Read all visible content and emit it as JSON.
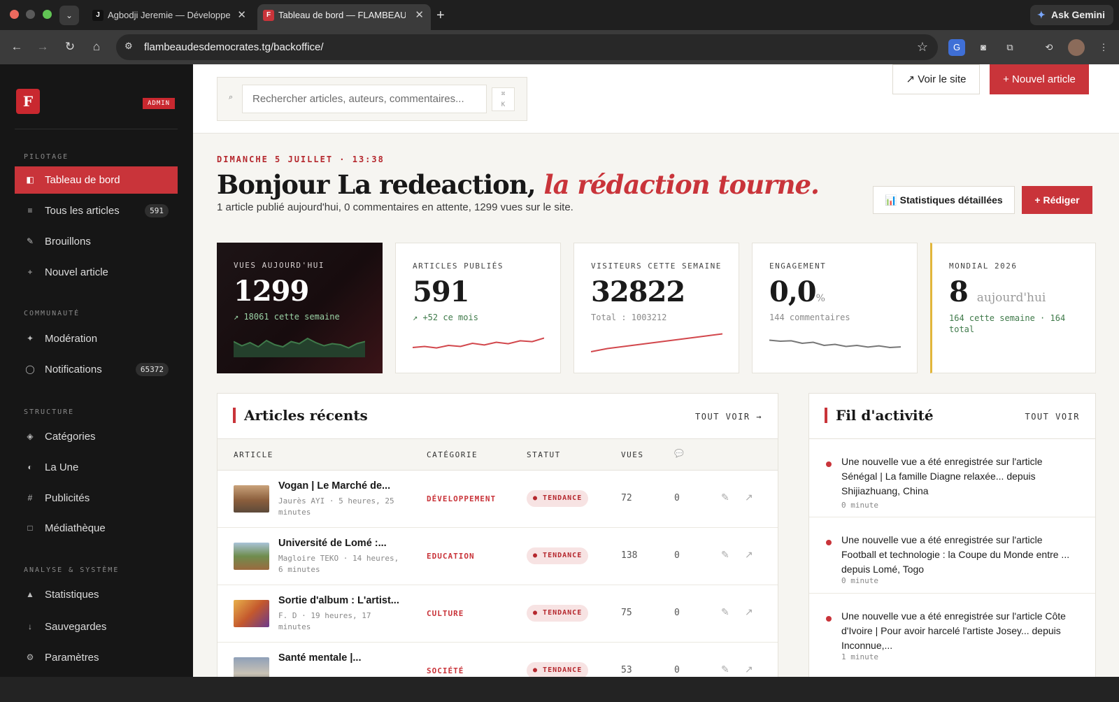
{
  "browser": {
    "tabs": [
      {
        "favicon": "J",
        "title": "Agbodji Jeremie — Développe",
        "active": false
      },
      {
        "favicon": "F",
        "title": "Tableau de bord — FLAMBEAU",
        "active": true
      }
    ],
    "gemini_label": "Ask Gemini",
    "url": "flambeaudesdemocrates.tg/backoffice/"
  },
  "sidebar": {
    "logo": "F",
    "badge": "ADMIN",
    "sections": {
      "pilotage": "PILOTAGE",
      "communaute": "COMMUNAUTÉ",
      "structure": "STRUCTURE",
      "analyse": "ANALYSE & SYSTÈME"
    },
    "items": {
      "dashboard": {
        "label": "Tableau de bord",
        "icon": "◧"
      },
      "articles": {
        "label": "Tous les articles",
        "icon": "≡",
        "count": "591"
      },
      "drafts": {
        "label": "Brouillons",
        "icon": "✎"
      },
      "new": {
        "label": "Nouvel article",
        "icon": "+"
      },
      "moderation": {
        "label": "Modération",
        "icon": "✦"
      },
      "notifications": {
        "label": "Notifications",
        "icon": "◯",
        "count": "65372"
      },
      "categories": {
        "label": "Catégories",
        "icon": "◈"
      },
      "laune": {
        "label": "La Une",
        "icon": "◐"
      },
      "pubs": {
        "label": "Publicités",
        "icon": "#"
      },
      "media": {
        "label": "Médiathèque",
        "icon": "□"
      },
      "stats": {
        "label": "Statistiques",
        "icon": "▲"
      },
      "backups": {
        "label": "Sauvegardes",
        "icon": "↓"
      },
      "settings": {
        "label": "Paramètres",
        "icon": "⚙"
      }
    }
  },
  "topbar": {
    "search_placeholder": "Rechercher articles, auteurs, commentaires...",
    "kbd_top": "⌘",
    "kbd_bottom": "K",
    "view_site": "↗ Voir le site",
    "new_article": "+ Nouvel article"
  },
  "header": {
    "date": "DIMANCHE 5 JUILLET · 13:38",
    "greeting": "Bonjour La redeaction,",
    "greeting_accent": "la rédaction tourne.",
    "summary": "1 article publié aujourd'hui, 0 commentaires en attente, 1299 vues sur le site.",
    "stats_button": "📊 Statistiques détaillées",
    "write_button": "+ Rédiger"
  },
  "stats": {
    "views": {
      "label": "VUES AUJOURD'HUI",
      "value": "1299",
      "note": "↗ 18061 cette semaine",
      "spark": [
        0.55,
        0.35,
        0.5,
        0.3,
        0.6,
        0.4,
        0.3,
        0.55,
        0.45,
        0.7,
        0.5,
        0.35,
        0.45,
        0.4,
        0.25,
        0.45,
        0.55
      ]
    },
    "articles": {
      "label": "ARTICLES PUBLIÉS",
      "value": "591",
      "note": "↗ +52 ce mois",
      "spark": [
        0.3,
        0.35,
        0.28,
        0.4,
        0.35,
        0.5,
        0.42,
        0.55,
        0.48,
        0.62,
        0.58,
        0.75
      ]
    },
    "visitors": {
      "label": "VISITEURS CETTE SEMAINE",
      "value": "32822",
      "note": "Total : 1003212",
      "spark": [
        0.1,
        0.25,
        0.35,
        0.45,
        0.55,
        0.65,
        0.75,
        0.85,
        0.95
      ]
    },
    "engagement": {
      "label": "ENGAGEMENT",
      "value": "0,0",
      "unit": "%",
      "note": "144 commentaires",
      "spark": [
        0.65,
        0.6,
        0.62,
        0.5,
        0.55,
        0.4,
        0.45,
        0.35,
        0.4,
        0.32,
        0.38,
        0.3,
        0.33
      ]
    },
    "mondial": {
      "label": "MONDIAL 2026",
      "value": "8",
      "unit": "aujourd'hui",
      "note": "164 cette semaine · 164 total"
    }
  },
  "recent": {
    "title": "Articles récents",
    "link": "TOUT VOIR →",
    "columns": {
      "article": "ARTICLE",
      "category": "CATÉGORIE",
      "status": "STATUT",
      "views": "VUES",
      "comments_icon": "💬"
    },
    "rows": [
      {
        "title": "Vogan | Le Marché de...",
        "meta": "Jaurès AYI · 5 heures, 25 minutes",
        "category": "DÉVELOPPEMENT",
        "status": "TENDANCE",
        "views": "72",
        "comments": "0",
        "thumb": "#a07a55"
      },
      {
        "title": "Université de Lomé :...",
        "meta": "Magloire TEKO · 14 heures, 6 minutes",
        "category": "EDUCATION",
        "status": "TENDANCE",
        "views": "138",
        "comments": "0",
        "thumb": "#7d8e5c"
      },
      {
        "title": "Sortie d'album : L'artist...",
        "meta": "F. D · 19 heures, 17 minutes",
        "category": "CULTURE",
        "status": "TENDANCE",
        "views": "75",
        "comments": "0",
        "thumb": "#c9862c"
      },
      {
        "title": "Santé mentale |...",
        "meta": "",
        "category": "SOCIÉTÉ",
        "status": "TENDANCE",
        "views": "53",
        "comments": "0",
        "thumb": "#7f8fa3"
      }
    ]
  },
  "feed": {
    "title": "Fil d'activité",
    "link": "TOUT VOIR",
    "items": [
      {
        "text": "Une nouvelle vue a été enregistrée sur l'article Sénégal | La famille Diagne relaxée... depuis Shijiazhuang, China",
        "time": "0 minute"
      },
      {
        "text": "Une nouvelle vue a été enregistrée sur l'article Football et technologie : la Coupe du Monde entre ... depuis Lomé, Togo",
        "time": "0 minute"
      },
      {
        "text": "Une nouvelle vue a été enregistrée sur l'article Côte d'Ivoire | Pour avoir harcelé l'artiste Josey... depuis Inconnue,...",
        "time": "1 minute"
      }
    ]
  },
  "colors": {
    "accent": "#c9343a",
    "sidebar": "#161616",
    "gold": "#e2b63b",
    "green": "#3f7a4a"
  }
}
